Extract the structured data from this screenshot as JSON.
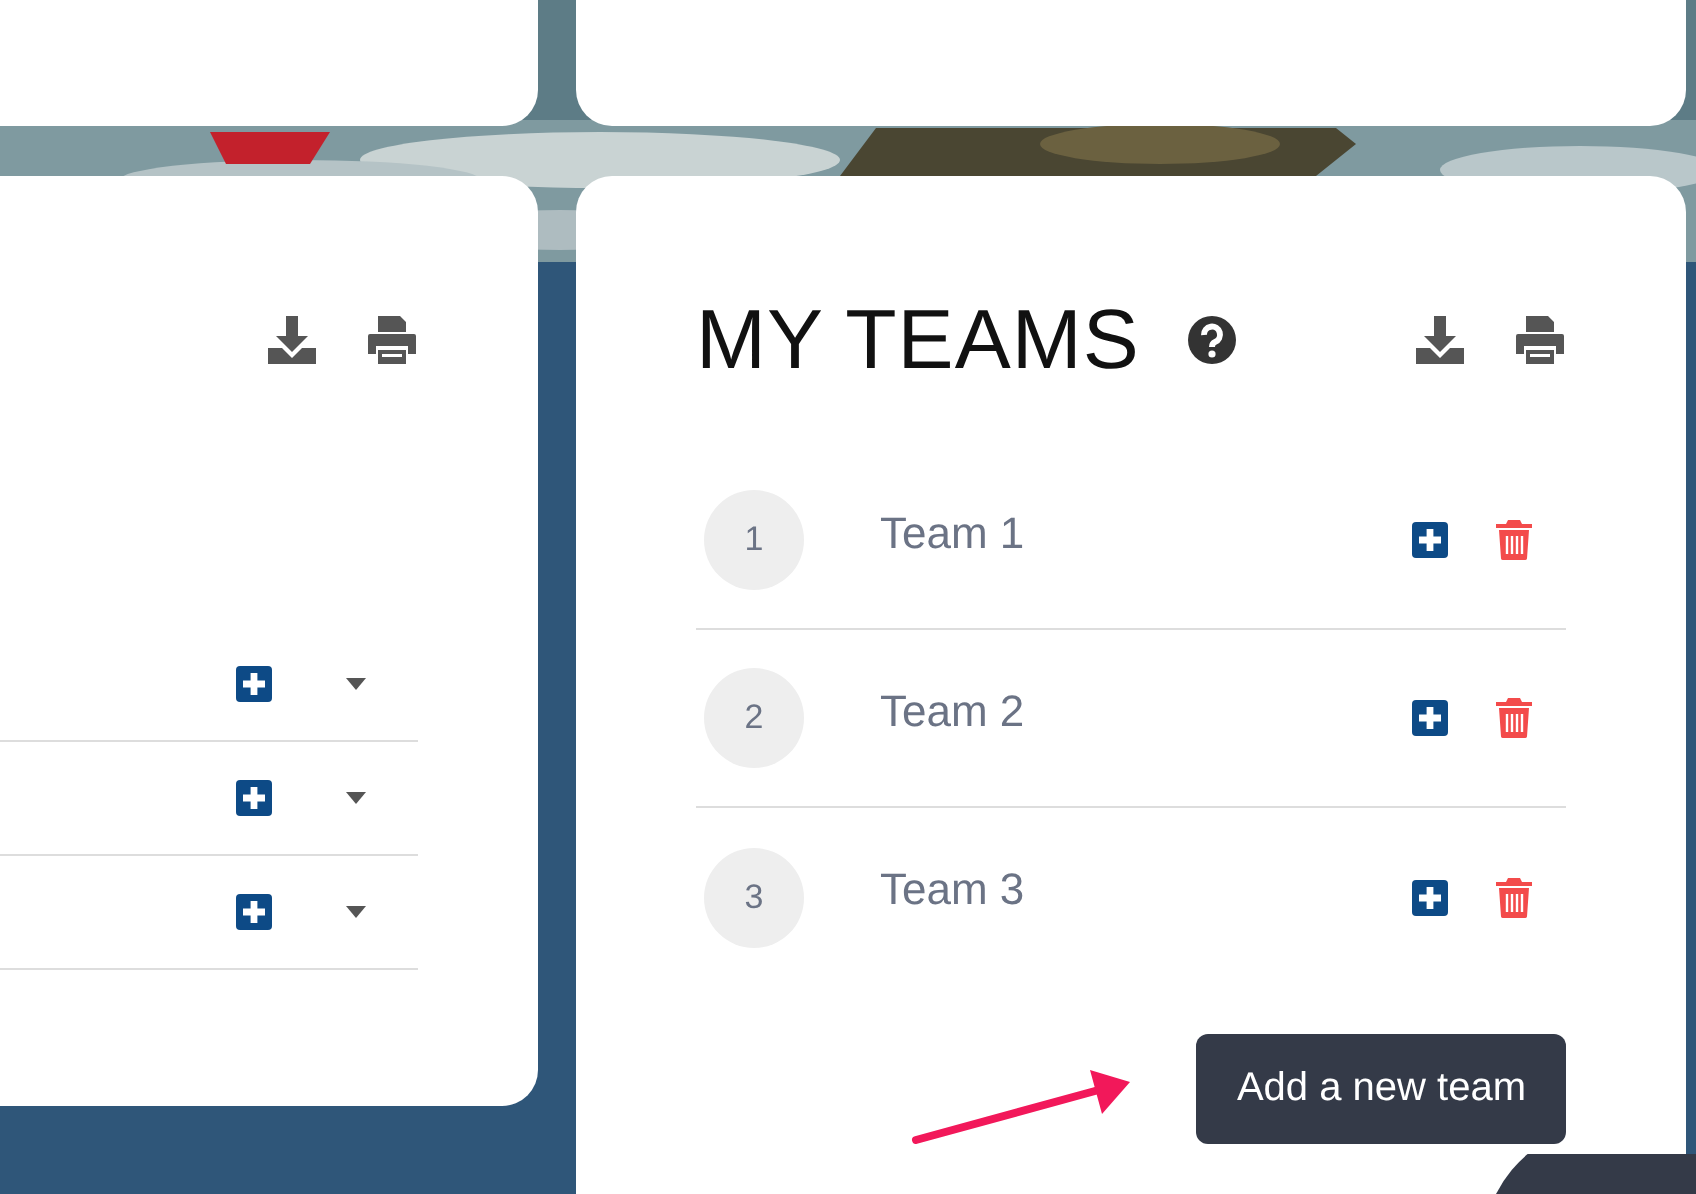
{
  "left_panel": {
    "rows": [
      {
        "kind": "expandable"
      },
      {
        "kind": "expandable"
      },
      {
        "kind": "expandable"
      }
    ]
  },
  "my_teams": {
    "title": "MY TEAMS",
    "teams": [
      {
        "number": "1",
        "name": "Team 1"
      },
      {
        "number": "2",
        "name": "Team 2"
      },
      {
        "number": "3",
        "name": "Team 3"
      }
    ],
    "add_button": "Add a new team"
  }
}
